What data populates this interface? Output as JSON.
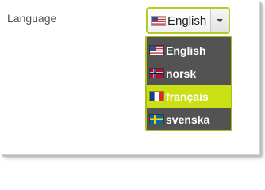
{
  "form": {
    "language_label": "Language",
    "selected_value": "English",
    "selected_flag": "flag-us-icon"
  },
  "dropdown": {
    "options": [
      {
        "label": "English",
        "flag": "flag-us-icon",
        "active": false
      },
      {
        "label": "norsk",
        "flag": "flag-norway-icon",
        "active": false
      },
      {
        "label": "français",
        "flag": "flag-france-icon",
        "active": true
      },
      {
        "label": "svenska",
        "flag": "flag-sweden-icon",
        "active": false
      }
    ]
  },
  "colors": {
    "accent": "#b6cc24",
    "highlight": "#cadf14",
    "menu_bg": "#535353"
  }
}
